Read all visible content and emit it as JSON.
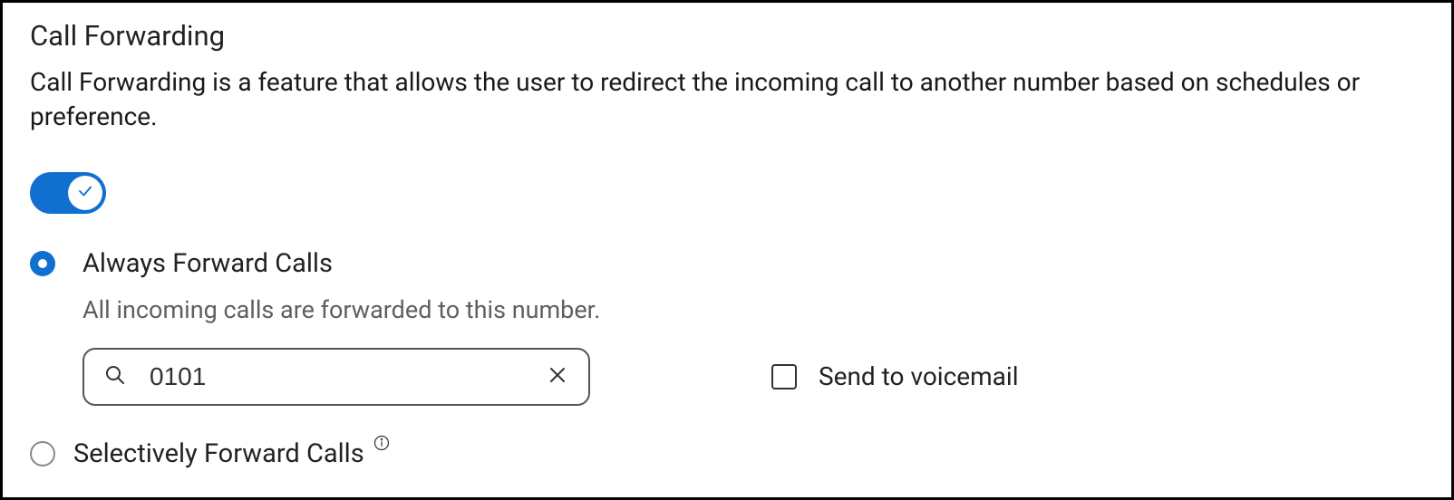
{
  "title": "Call Forwarding",
  "description": "Call Forwarding is a feature that allows the user to redirect the incoming call to another number based on schedules or preference.",
  "toggle": {
    "on": true
  },
  "options": {
    "always": {
      "label": "Always Forward Calls",
      "helper": "All incoming calls are forwarded to this number.",
      "number_value": "0101",
      "voicemail_label": "Send to voicemail",
      "voicemail_checked": false,
      "selected": true
    },
    "selective": {
      "label": "Selectively Forward Calls",
      "selected": false
    }
  },
  "colors": {
    "accent": "#1170cf"
  }
}
